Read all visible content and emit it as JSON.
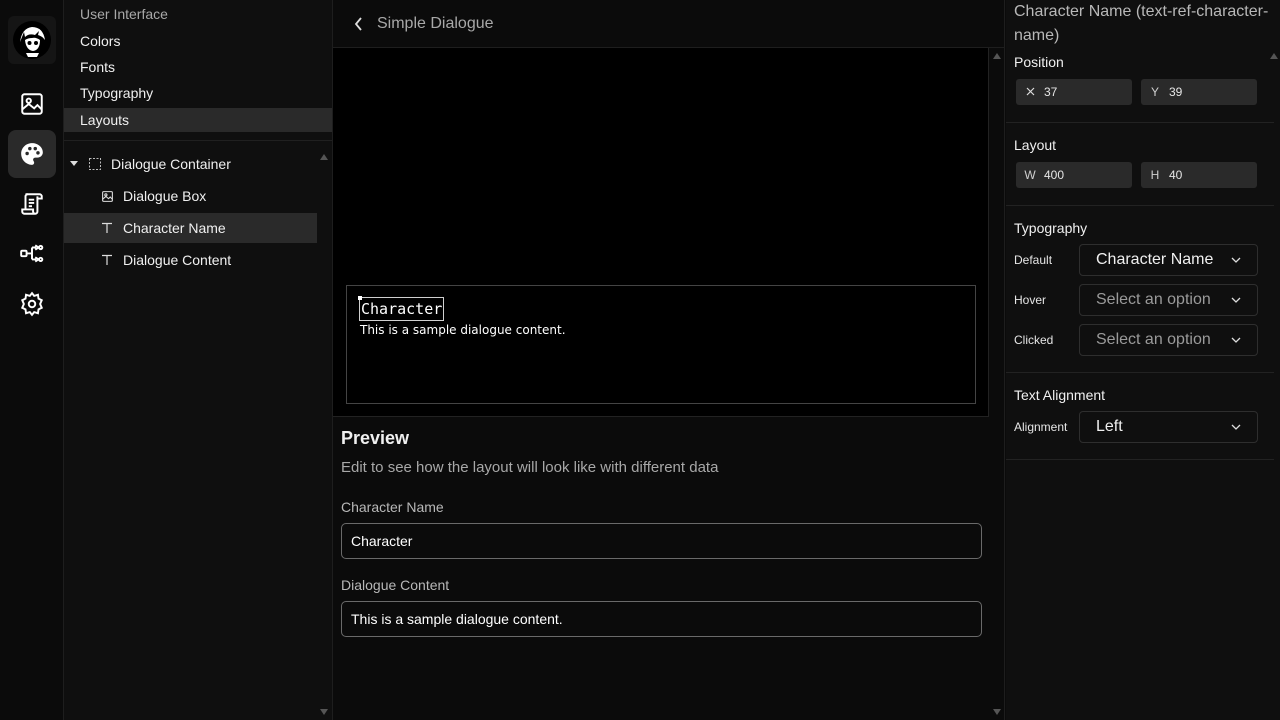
{
  "rail": {
    "items": [
      {
        "name": "logo"
      },
      {
        "name": "images-icon"
      },
      {
        "name": "palette-icon",
        "active": true
      },
      {
        "name": "script-icon"
      },
      {
        "name": "flow-icon"
      },
      {
        "name": "settings-icon"
      }
    ]
  },
  "sidebar": {
    "menu": [
      {
        "label": "User Interface",
        "dim": true
      },
      {
        "label": "Colors"
      },
      {
        "label": "Fonts"
      },
      {
        "label": "Typography"
      },
      {
        "label": "Layouts",
        "selected": true
      }
    ],
    "tree": [
      {
        "label": "Dialogue Container",
        "icon": "container-icon"
      },
      {
        "label": "Dialogue Box",
        "icon": "image-icon"
      },
      {
        "label": "Character Name",
        "icon": "text-icon",
        "selected": true
      },
      {
        "label": "Dialogue Content",
        "icon": "text-icon"
      }
    ]
  },
  "center": {
    "title": "Simple Dialogue",
    "canvas": {
      "character_name": "Character",
      "dialogue_content": "This is a sample dialogue content."
    },
    "preview": {
      "title": "Preview",
      "subtitle": "Edit to see how the layout will look like with different data",
      "fields": [
        {
          "label": "Character Name",
          "value": "Character"
        },
        {
          "label": "Dialogue Content",
          "value": "This is a sample dialogue content."
        }
      ]
    }
  },
  "props": {
    "title": "Character Name (text-ref-character-name)",
    "position": {
      "label": "Position",
      "x_axis": "X",
      "x": "37",
      "y_axis": "Y",
      "y": "39"
    },
    "layout": {
      "label": "Layout",
      "w_axis": "W",
      "w": "400",
      "h_axis": "H",
      "h": "40"
    },
    "typography": {
      "label": "Typography",
      "default_label": "Default",
      "default_value": "Character Name",
      "hover_label": "Hover",
      "hover_value": "Select an option",
      "clicked_label": "Clicked",
      "clicked_value": "Select an option"
    },
    "alignment": {
      "label": "Text Alignment",
      "field_label": "Alignment",
      "value": "Left"
    }
  },
  "colors": {
    "background": "#0b0b0b",
    "panel": "#0f0f0f",
    "selected": "#2a2a2a",
    "text": "#f0f0f0",
    "muted": "#a8a8a8"
  }
}
